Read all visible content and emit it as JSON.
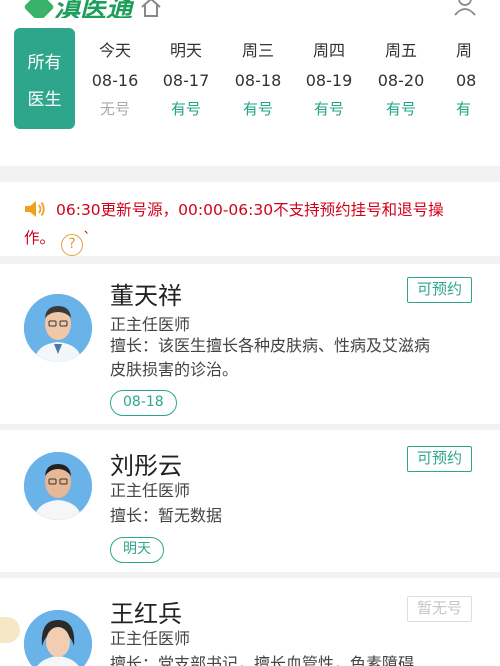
{
  "header": {
    "logo_text": "滇医通"
  },
  "date_selector": {
    "all_doctors": [
      "所有",
      "医生"
    ],
    "days": [
      {
        "day": "今天",
        "date": "08-16",
        "status": "无号",
        "available": false
      },
      {
        "day": "明天",
        "date": "08-17",
        "status": "有号",
        "available": true
      },
      {
        "day": "周三",
        "date": "08-18",
        "status": "有号",
        "available": true
      },
      {
        "day": "周四",
        "date": "08-19",
        "status": "有号",
        "available": true
      },
      {
        "day": "周五",
        "date": "08-20",
        "status": "有号",
        "available": true
      },
      {
        "day": "周",
        "date": "08",
        "status": "有",
        "available": true
      }
    ]
  },
  "notice": {
    "line1": "06:30更新号源，00:00-06:30不支持预约挂号和退号操",
    "line2": "作。",
    "line2_suffix": "`",
    "help_icon": "?"
  },
  "doctors": [
    {
      "name": "董天祥",
      "title": "正主任医师",
      "specialty_line1": "擅长：该医生擅长各种皮肤病、性病及艾滋病",
      "specialty_line2": "皮肤损害的诊治。",
      "date_tag": "08-18",
      "action": "可预约"
    },
    {
      "name": "刘彤云",
      "title": "正主任医师",
      "specialty_line1": "擅长：暂无数据",
      "date_tag": "明天",
      "action": "可预约"
    },
    {
      "name": "王红兵",
      "title": "正主任医师",
      "specialty_line1": "擅长：党支部书记，擅长血管性，色素障碍",
      "action": "暂无号"
    }
  ],
  "colors": {
    "accent": "#2ea68c",
    "notice_red": "#d0021b",
    "unavailable": "#aaaaaa"
  }
}
